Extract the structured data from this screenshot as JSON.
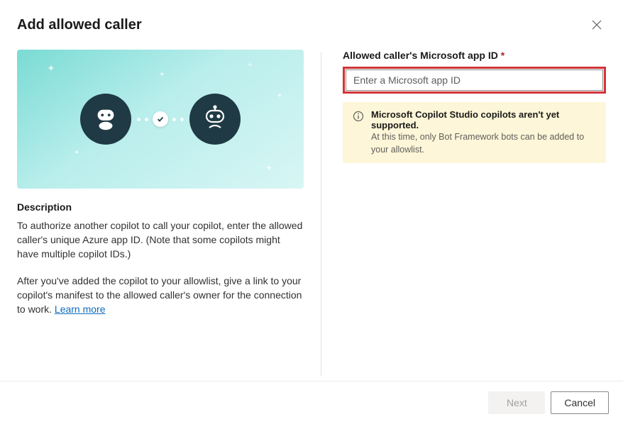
{
  "dialog": {
    "title": "Add allowed caller"
  },
  "description": {
    "heading": "Description",
    "para1": "To authorize another copilot to call your copilot, enter the allowed caller's unique Azure app ID. (Note that some copilots might have multiple copilot IDs.)",
    "para2_prefix": "After you've added the copilot to your allowlist, give a link to your copilot's manifest to the allowed caller's owner for the connection to work. ",
    "learn_more": "Learn more"
  },
  "form": {
    "label": "Allowed caller's Microsoft app ID",
    "required_marker": "*",
    "placeholder": "Enter a Microsoft app ID"
  },
  "banner": {
    "title": "Microsoft Copilot Studio copilots aren't yet supported.",
    "body": "At this time, only Bot Framework bots can be added to your allowlist."
  },
  "buttons": {
    "next": "Next",
    "cancel": "Cancel"
  }
}
